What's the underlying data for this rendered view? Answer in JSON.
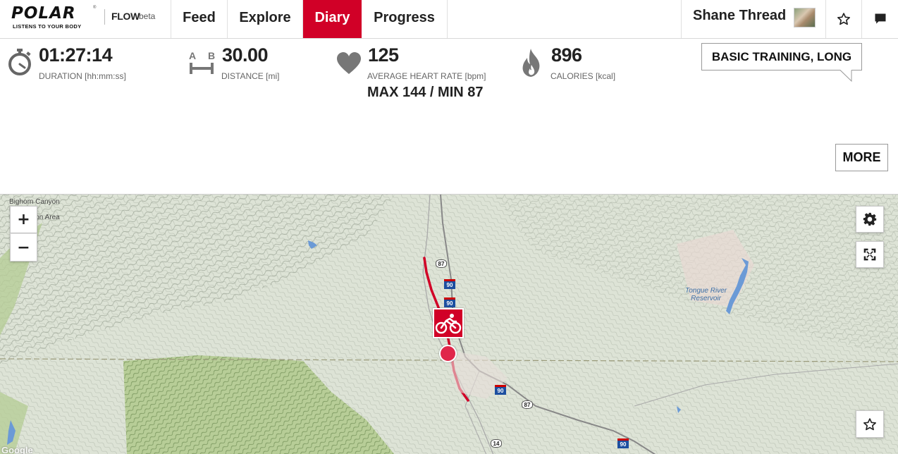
{
  "brand": {
    "logo_text": "POLAR",
    "registered_mark": "®",
    "tagline": "LISTENS TO YOUR BODY",
    "product": "FLOW",
    "product_suffix": "beta"
  },
  "nav": {
    "items": [
      {
        "label": "Feed",
        "active": false
      },
      {
        "label": "Explore",
        "active": false
      },
      {
        "label": "Diary",
        "active": true
      },
      {
        "label": "Progress",
        "active": false
      }
    ],
    "accent_color": "#d10027"
  },
  "user": {
    "name": "Shane Thread",
    "icons": [
      "avatar",
      "star-icon",
      "message-icon"
    ]
  },
  "stats": {
    "duration": {
      "value": "01:27:14",
      "label": "DURATION [hh:mm:ss]",
      "icon": "stopwatch-icon"
    },
    "distance": {
      "value": "30.00",
      "label": "DISTANCE [mi]",
      "icon": "distance-ab-icon",
      "icon_a": "A",
      "icon_b": "B"
    },
    "heart_rate": {
      "value": "125",
      "label": "AVERAGE HEART RATE [bpm]",
      "icon": "heart-icon",
      "extra": "MAX 144  /  MIN 87"
    },
    "calories": {
      "value": "896",
      "label": "CALORIES [kcal]",
      "icon": "flame-icon"
    }
  },
  "sport_profile": {
    "label": "BASIC TRAINING, LONG"
  },
  "more_button": {
    "label": "MORE"
  },
  "map": {
    "labels": {
      "bighorn": "Bighorn Canyon\nNational\nRecreation Area",
      "tongue_river": "Tongue River\nReservoir",
      "attribution": "Google"
    },
    "highways": {
      "us87_north": "87",
      "i90_north": "90",
      "i90_south": "90",
      "us87_south": "87",
      "us14": "14",
      "i90_east": "90"
    },
    "controls": {
      "zoom_in": "+",
      "zoom_out": "−",
      "settings_icon": "gear-icon",
      "fullscreen_icon": "fullscreen-icon",
      "favorite_icon": "star-icon"
    },
    "markers": {
      "sport_icon": "cycling-icon"
    },
    "colors": {
      "route": "#d10027",
      "water": "#6b9ad6",
      "forest": "#b9cf9b",
      "land": "#dfe4d8"
    }
  }
}
